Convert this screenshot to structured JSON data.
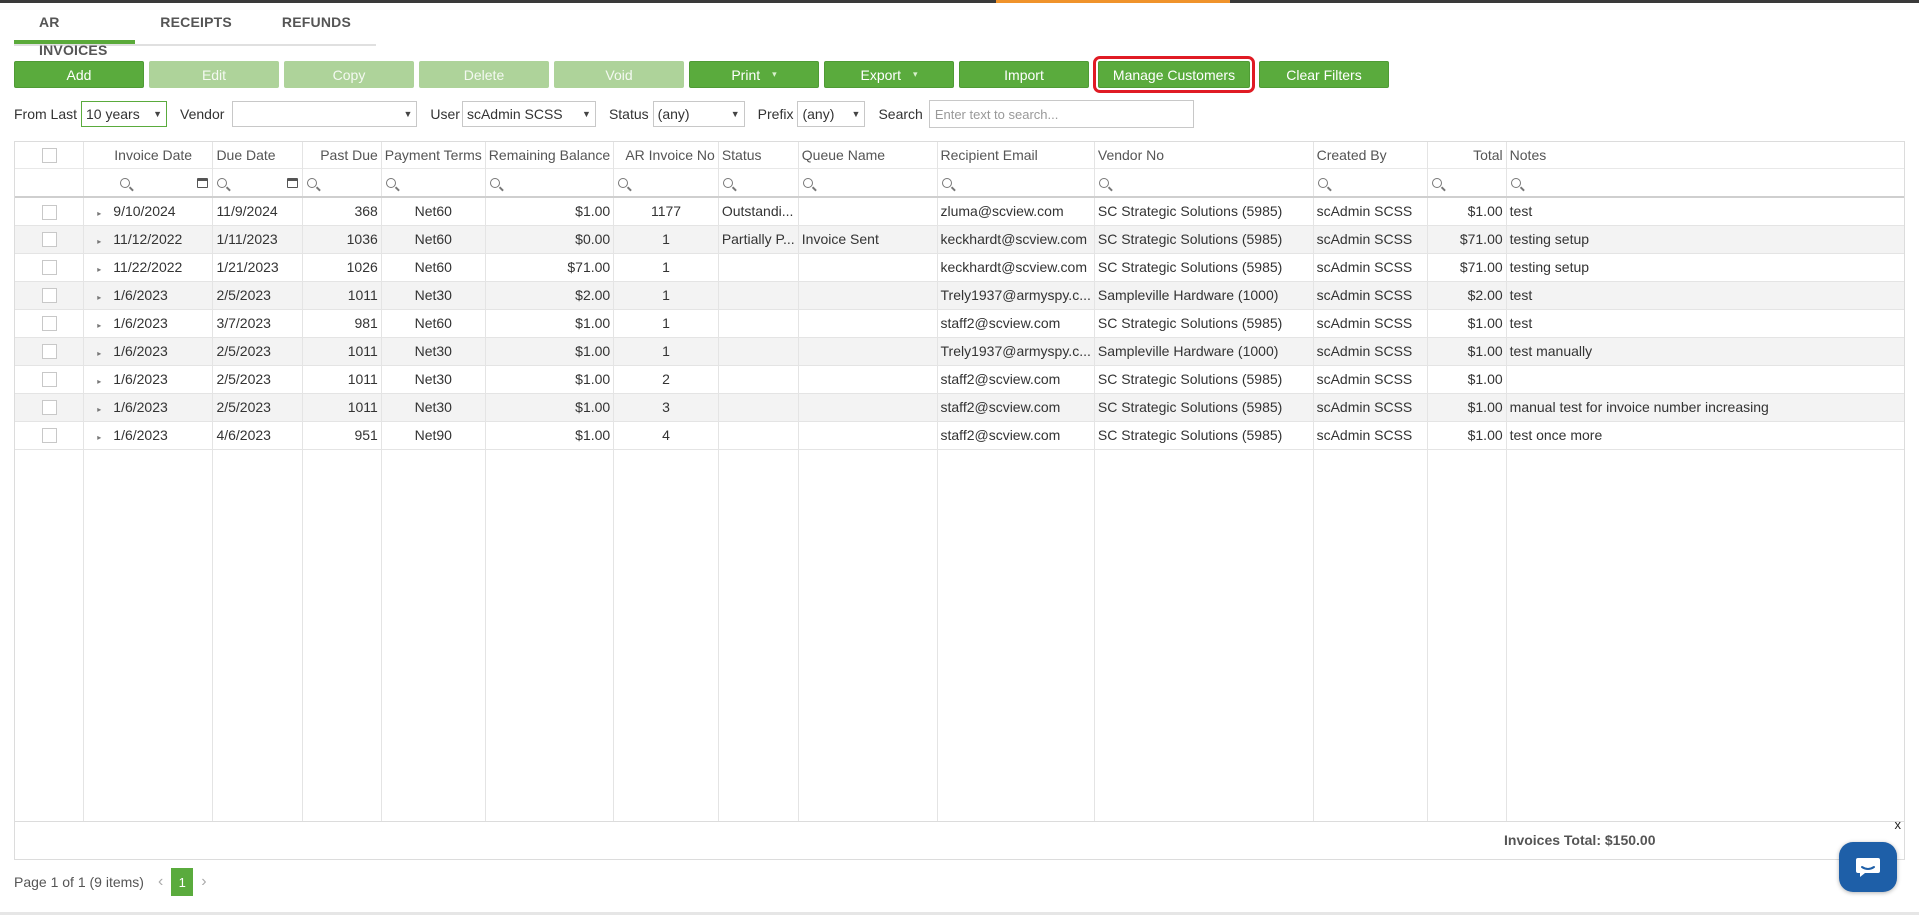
{
  "tabs": [
    "AR INVOICES",
    "RECEIPTS",
    "REFUNDS"
  ],
  "toolbar": {
    "add": "Add",
    "edit": "Edit",
    "copy": "Copy",
    "delete": "Delete",
    "void": "Void",
    "print": "Print",
    "export": "Export",
    "import": "Import",
    "manage_customers": "Manage Customers",
    "clear_filters": "Clear Filters"
  },
  "filters": {
    "from_last_label": "From Last",
    "from_last_value": "10 years",
    "vendor_label": "Vendor",
    "vendor_value": "",
    "user_label": "User",
    "user_value": "scAdmin SCSS",
    "status_label": "Status",
    "status_value": "(any)",
    "prefix_label": "Prefix",
    "prefix_value": "(any)",
    "search_label": "Search",
    "search_placeholder": "Enter text to search..."
  },
  "columns": [
    "Invoice Date",
    "Due Date",
    "Past Due",
    "Payment Terms",
    "Remaining Balance",
    "AR Invoice No",
    "Status",
    "Queue Name",
    "Recipient Email",
    "Vendor No",
    "Created By",
    "Total",
    "Notes"
  ],
  "rows": [
    [
      "9/10/2024",
      "11/9/2024",
      "368",
      "Net60",
      "$1.00",
      "1177",
      "Outstandi...",
      "",
      "zluma@scview.com",
      "SC Strategic Solutions (5985)",
      "scAdmin SCSS",
      "$1.00",
      "test"
    ],
    [
      "11/12/2022",
      "1/11/2023",
      "1036",
      "Net60",
      "$0.00",
      "1",
      "Partially P...",
      "Invoice Sent",
      "keckhardt@scview.com",
      "SC Strategic Solutions (5985)",
      "scAdmin SCSS",
      "$71.00",
      "testing setup"
    ],
    [
      "11/22/2022",
      "1/21/2023",
      "1026",
      "Net60",
      "$71.00",
      "1",
      "",
      "",
      "keckhardt@scview.com",
      "SC Strategic Solutions (5985)",
      "scAdmin SCSS",
      "$71.00",
      "testing setup"
    ],
    [
      "1/6/2023",
      "2/5/2023",
      "1011",
      "Net30",
      "$2.00",
      "1",
      "",
      "",
      "Trely1937@armyspy.c...",
      "Sampleville Hardware (1000)",
      "scAdmin SCSS",
      "$2.00",
      "test"
    ],
    [
      "1/6/2023",
      "3/7/2023",
      "981",
      "Net60",
      "$1.00",
      "1",
      "",
      "",
      "staff2@scview.com",
      "SC Strategic Solutions (5985)",
      "scAdmin SCSS",
      "$1.00",
      "test"
    ],
    [
      "1/6/2023",
      "2/5/2023",
      "1011",
      "Net30",
      "$1.00",
      "1",
      "",
      "",
      "Trely1937@armyspy.c...",
      "Sampleville Hardware (1000)",
      "scAdmin SCSS",
      "$1.00",
      "test manually"
    ],
    [
      "1/6/2023",
      "2/5/2023",
      "1011",
      "Net30",
      "$1.00",
      "2",
      "",
      "",
      "staff2@scview.com",
      "SC Strategic Solutions (5985)",
      "scAdmin SCSS",
      "$1.00",
      ""
    ],
    [
      "1/6/2023",
      "2/5/2023",
      "1011",
      "Net30",
      "$1.00",
      "3",
      "",
      "",
      "staff2@scview.com",
      "SC Strategic Solutions (5985)",
      "scAdmin SCSS",
      "$1.00",
      "manual test for invoice number increasing"
    ],
    [
      "1/6/2023",
      "4/6/2023",
      "951",
      "Net90",
      "$1.00",
      "4",
      "",
      "",
      "staff2@scview.com",
      "SC Strategic Solutions (5985)",
      "scAdmin SCSS",
      "$1.00",
      "test once more"
    ]
  ],
  "footer": {
    "invoices_total": "Invoices Total: $150.00",
    "close": "x"
  },
  "pager": {
    "summary": "Page 1 of 1 (9 items)",
    "current_page": "1"
  },
  "colors": {
    "accent_green": "#5aab3d",
    "disabled_green": "#aed39a",
    "highlight_red": "#e01b24",
    "chat_blue": "#1e5fa8",
    "top_accent_orange": "#f0932b"
  },
  "icons": {
    "filter": "magnifier-icon",
    "date": "calendar-icon",
    "expand": "caret-right-icon",
    "chat": "chat-icon"
  }
}
